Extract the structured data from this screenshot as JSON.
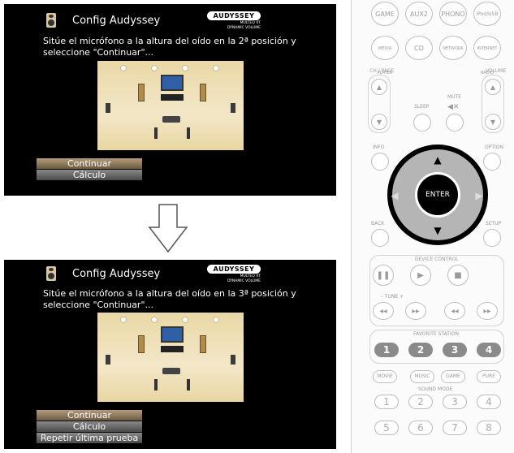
{
  "screens": [
    {
      "title": "Config Audyssey",
      "logo": {
        "word": "AUDYSSEY",
        "sub1": "MULTEQ XT",
        "sub2": "DYNAMIC VOLUME"
      },
      "instruction_line1": "Sitúe el micrófono a la altura del oído en la 2ª posición y",
      "instruction_line2": "seleccione \"Continuar\"...",
      "menu": [
        "Continuar",
        "Cálculo"
      ]
    },
    {
      "title": "Config Audyssey",
      "logo": {
        "word": "AUDYSSEY",
        "sub1": "MULTEQ XT",
        "sub2": "DYNAMIC VOLUME"
      },
      "instruction_line1": "Sitúe el micrófono a la altura del oído en la 3ª posición y",
      "instruction_line2": "seleccione \"Continuar\"...",
      "menu": [
        "Continuar",
        "Cálculo",
        "Repetir última prueba"
      ]
    }
  ],
  "remote": {
    "top_row": [
      "GAME",
      "AUX2",
      "PHONO",
      "iPod/USB"
    ],
    "second_row": [
      "MEDIA PLAYER",
      "CD",
      "NETWORK",
      "INTERNET RADIO"
    ],
    "labels": {
      "ch_page": "CH / PAGE",
      "volume": "VOLUME",
      "sleep": "SLEEP",
      "mute": "MUTE",
      "info": "INFO",
      "option": "OPTION",
      "back": "BACK",
      "setup": "SETUP",
      "enter": "ENTER",
      "device_control": "DEVICE CONTROL",
      "tune": "TUNE",
      "favorite_station": "FAVORITE STATION",
      "sound_mode": "SOUND MODE"
    },
    "favorites": [
      "1",
      "2",
      "3",
      "4"
    ],
    "modes": [
      "MOVIE",
      "MUSIC",
      "GAME",
      "PURE"
    ],
    "numbers": [
      "1",
      "2",
      "3",
      "4",
      "5",
      "6",
      "7",
      "8"
    ]
  },
  "colors": {
    "screen_bg": "#000000",
    "active_menu": "#8f7a59",
    "inactive_menu": "#5d5d5d",
    "remote_gray": "#8a8a8a"
  }
}
